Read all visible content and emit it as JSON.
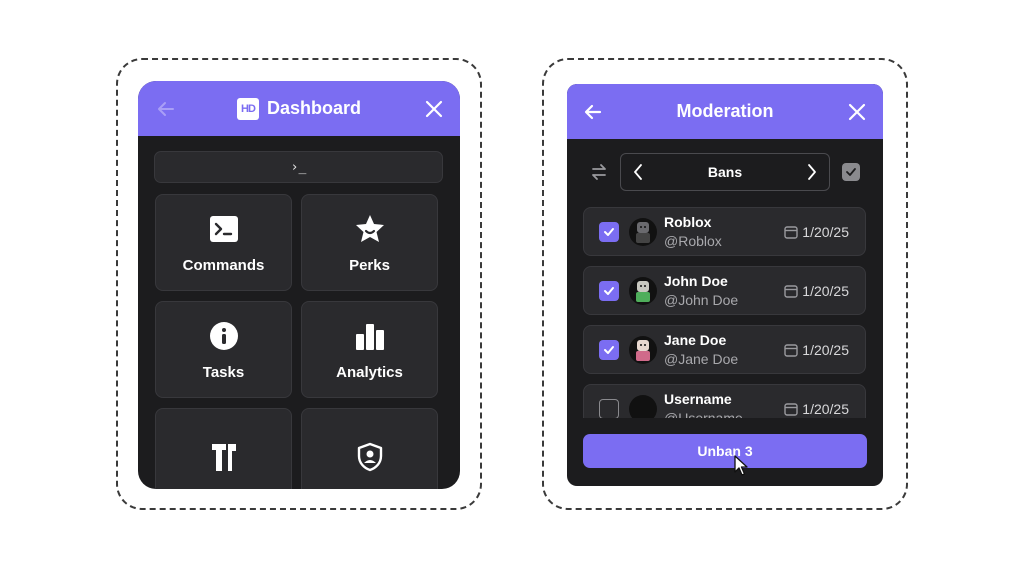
{
  "dashboard": {
    "logo_text": "HD",
    "title": "Dashboard",
    "command_prompt": "›_",
    "tiles": [
      {
        "label": "Commands",
        "icon": "terminal-icon"
      },
      {
        "label": "Perks",
        "icon": "star-icon"
      },
      {
        "label": "Tasks",
        "icon": "info-icon"
      },
      {
        "label": "Analytics",
        "icon": "bar-chart-icon"
      },
      {
        "label": "",
        "icon": "hammer-icon"
      },
      {
        "label": "",
        "icon": "shield-user-icon"
      }
    ]
  },
  "moderation": {
    "title": "Moderation",
    "filter_label": "Bans",
    "users": [
      {
        "name": "Roblox",
        "handle": "@Roblox",
        "date": "1/20/25",
        "checked": true
      },
      {
        "name": "John Doe",
        "handle": "@John Doe",
        "date": "1/20/25",
        "checked": true
      },
      {
        "name": "Jane Doe",
        "handle": "@Jane Doe",
        "date": "1/20/25",
        "checked": true
      },
      {
        "name": "Username",
        "handle": "@Username",
        "date": "1/20/25",
        "checked": false
      }
    ],
    "action_label": "Unban 3"
  },
  "colors": {
    "accent": "#7b6df2",
    "panel_bg": "#1c1c1e",
    "tile_bg": "#2a2a2d"
  }
}
